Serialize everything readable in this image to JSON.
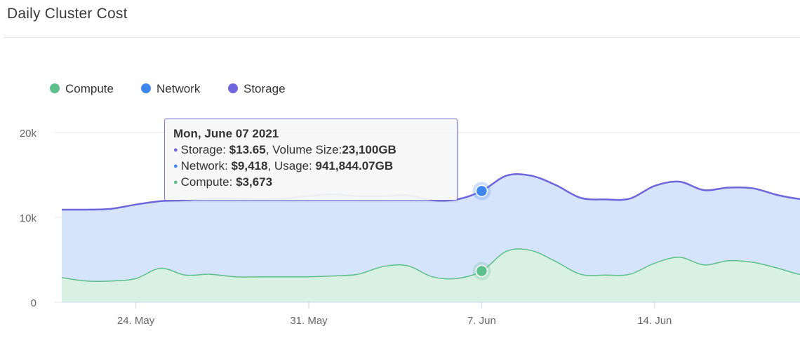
{
  "header": {
    "title": "Daily Cluster Cost"
  },
  "colors": {
    "compute": "#5cc08a",
    "network": "#3d86ee",
    "storage": "#6e66dc",
    "compute_fill": "#d9f1e3",
    "network_fill": "#d5e3fb",
    "grid": "#e8e8e8"
  },
  "tooltip": {
    "date": "Mon, June 07 2021",
    "storage_label": "Storage:",
    "storage_value": "$13.65",
    "storage_extra_label": ", Volume Size:",
    "storage_extra_value": "23,100GB",
    "network_label": "Network:",
    "network_value": "$9,418",
    "network_extra_label": ", Usage:",
    "network_extra_value": "941,844.07GB",
    "compute_label": "Compute:",
    "compute_value": "$3,673"
  },
  "chart_data": {
    "type": "area",
    "title": "Daily Cluster Cost",
    "stacked": true,
    "legend_position": "top-left",
    "grid": true,
    "ylim": [
      0,
      20000
    ],
    "y_ticks": [
      "0",
      "10k",
      "20k"
    ],
    "x_ticks": [
      "24. May",
      "31. May",
      "7. Jun",
      "14. Jun"
    ],
    "x_tick_days": [
      3,
      10,
      17,
      24
    ],
    "x_dates": [
      "2021-05-21",
      "2021-05-22",
      "2021-05-23",
      "2021-05-24",
      "2021-05-25",
      "2021-05-26",
      "2021-05-27",
      "2021-05-28",
      "2021-05-29",
      "2021-05-30",
      "2021-05-31",
      "2021-06-01",
      "2021-06-02",
      "2021-06-03",
      "2021-06-04",
      "2021-06-05",
      "2021-06-06",
      "2021-06-07",
      "2021-06-08",
      "2021-06-09",
      "2021-06-10",
      "2021-06-11",
      "2021-06-12",
      "2021-06-13",
      "2021-06-14",
      "2021-06-15",
      "2021-06-16",
      "2021-06-17",
      "2021-06-18",
      "2021-06-19",
      "2021-06-20",
      "2021-06-21"
    ],
    "series": [
      {
        "name": "Compute",
        "values": [
          2900,
          2500,
          2500,
          2800,
          4000,
          3200,
          3300,
          3000,
          3000,
          3000,
          3000,
          3100,
          3300,
          4200,
          4300,
          3000,
          2800,
          3673,
          6000,
          6100,
          4800,
          3300,
          3200,
          3300,
          4600,
          5300,
          4400,
          4900,
          4700,
          4000,
          3200,
          3100
        ]
      },
      {
        "name": "Network",
        "values": [
          8000,
          8400,
          8500,
          8700,
          7900,
          8800,
          8900,
          9200,
          9100,
          9200,
          9500,
          9600,
          9200,
          8300,
          8300,
          9000,
          9300,
          9418,
          8900,
          8800,
          9000,
          9000,
          8900,
          8900,
          9100,
          8900,
          8800,
          8600,
          8700,
          8600,
          8900,
          8800
        ]
      },
      {
        "name": "Storage",
        "values": [
          13,
          13,
          13,
          13,
          13,
          13,
          13,
          13,
          13,
          13,
          13,
          13,
          13,
          13,
          13,
          13,
          13,
          13.65,
          14,
          14,
          14,
          14,
          14,
          14,
          14,
          14,
          14,
          14,
          14,
          14,
          14,
          14
        ]
      }
    ]
  }
}
